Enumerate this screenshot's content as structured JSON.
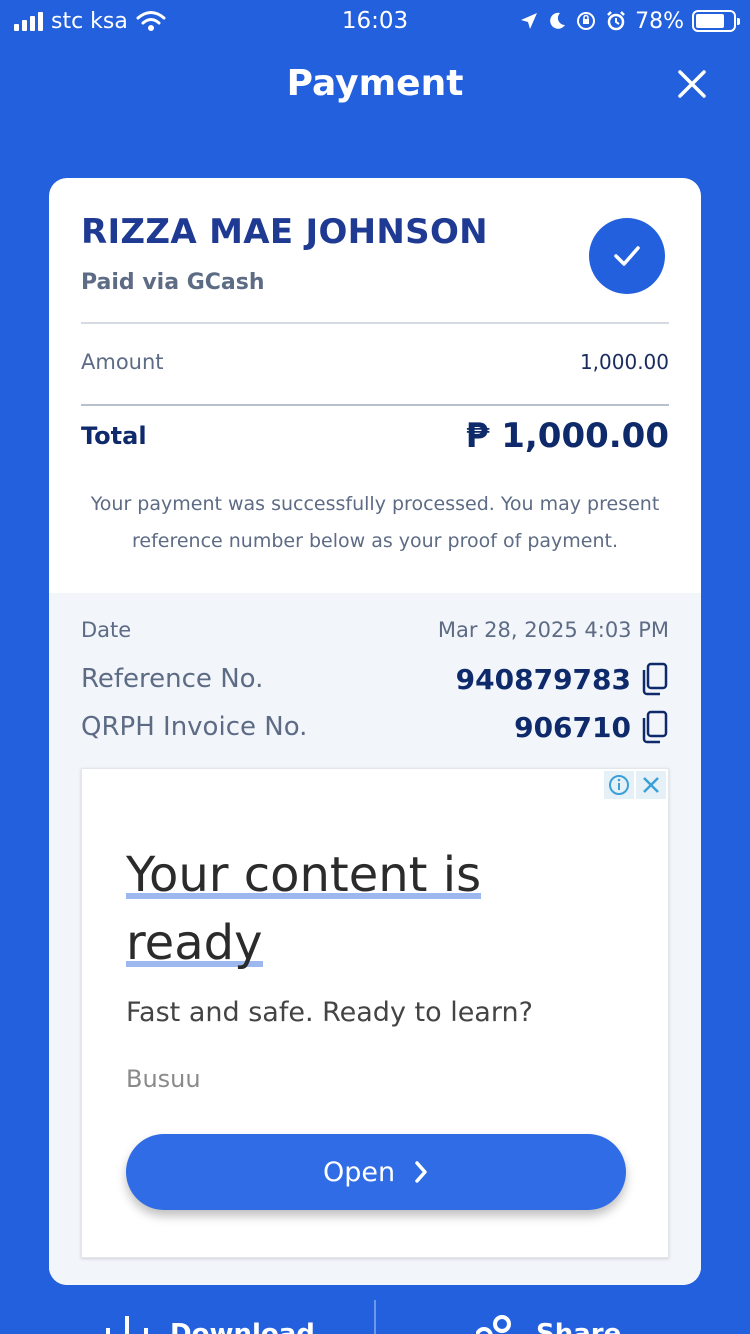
{
  "status_bar": {
    "carrier": "stc ksa",
    "time": "16:03",
    "battery": "78%",
    "battery_level": 0.78
  },
  "header": {
    "title": "Payment",
    "close_icon": "close-icon"
  },
  "receipt": {
    "payee_name": "RIZZA MAE JOHNSON",
    "paid_via": "Paid via GCash",
    "amount_label": "Amount",
    "amount_value": "1,000.00",
    "total_label": "Total",
    "total_value": "₱ 1,000.00",
    "success_message": "Your payment was successfully processed. You may present reference number below as your proof of payment."
  },
  "details": {
    "date_label": "Date",
    "date_value": "Mar 28, 2025 4:03 PM",
    "reference_label": "Reference No.",
    "reference_value": "940879783",
    "invoice_label": "QRPH Invoice No.",
    "invoice_value": "906710"
  },
  "ad": {
    "headline_line1": "Your content is",
    "headline_line2": "ready",
    "subtext": "Fast and safe. Ready to learn?",
    "brand": "Busuu",
    "cta": "Open"
  },
  "bottom_actions": {
    "download": "Download",
    "share": "Share"
  },
  "colors": {
    "background": "#2360dd",
    "accent": "#1f3a93",
    "card": "#ffffff",
    "details_bg": "#f2f6fb"
  }
}
